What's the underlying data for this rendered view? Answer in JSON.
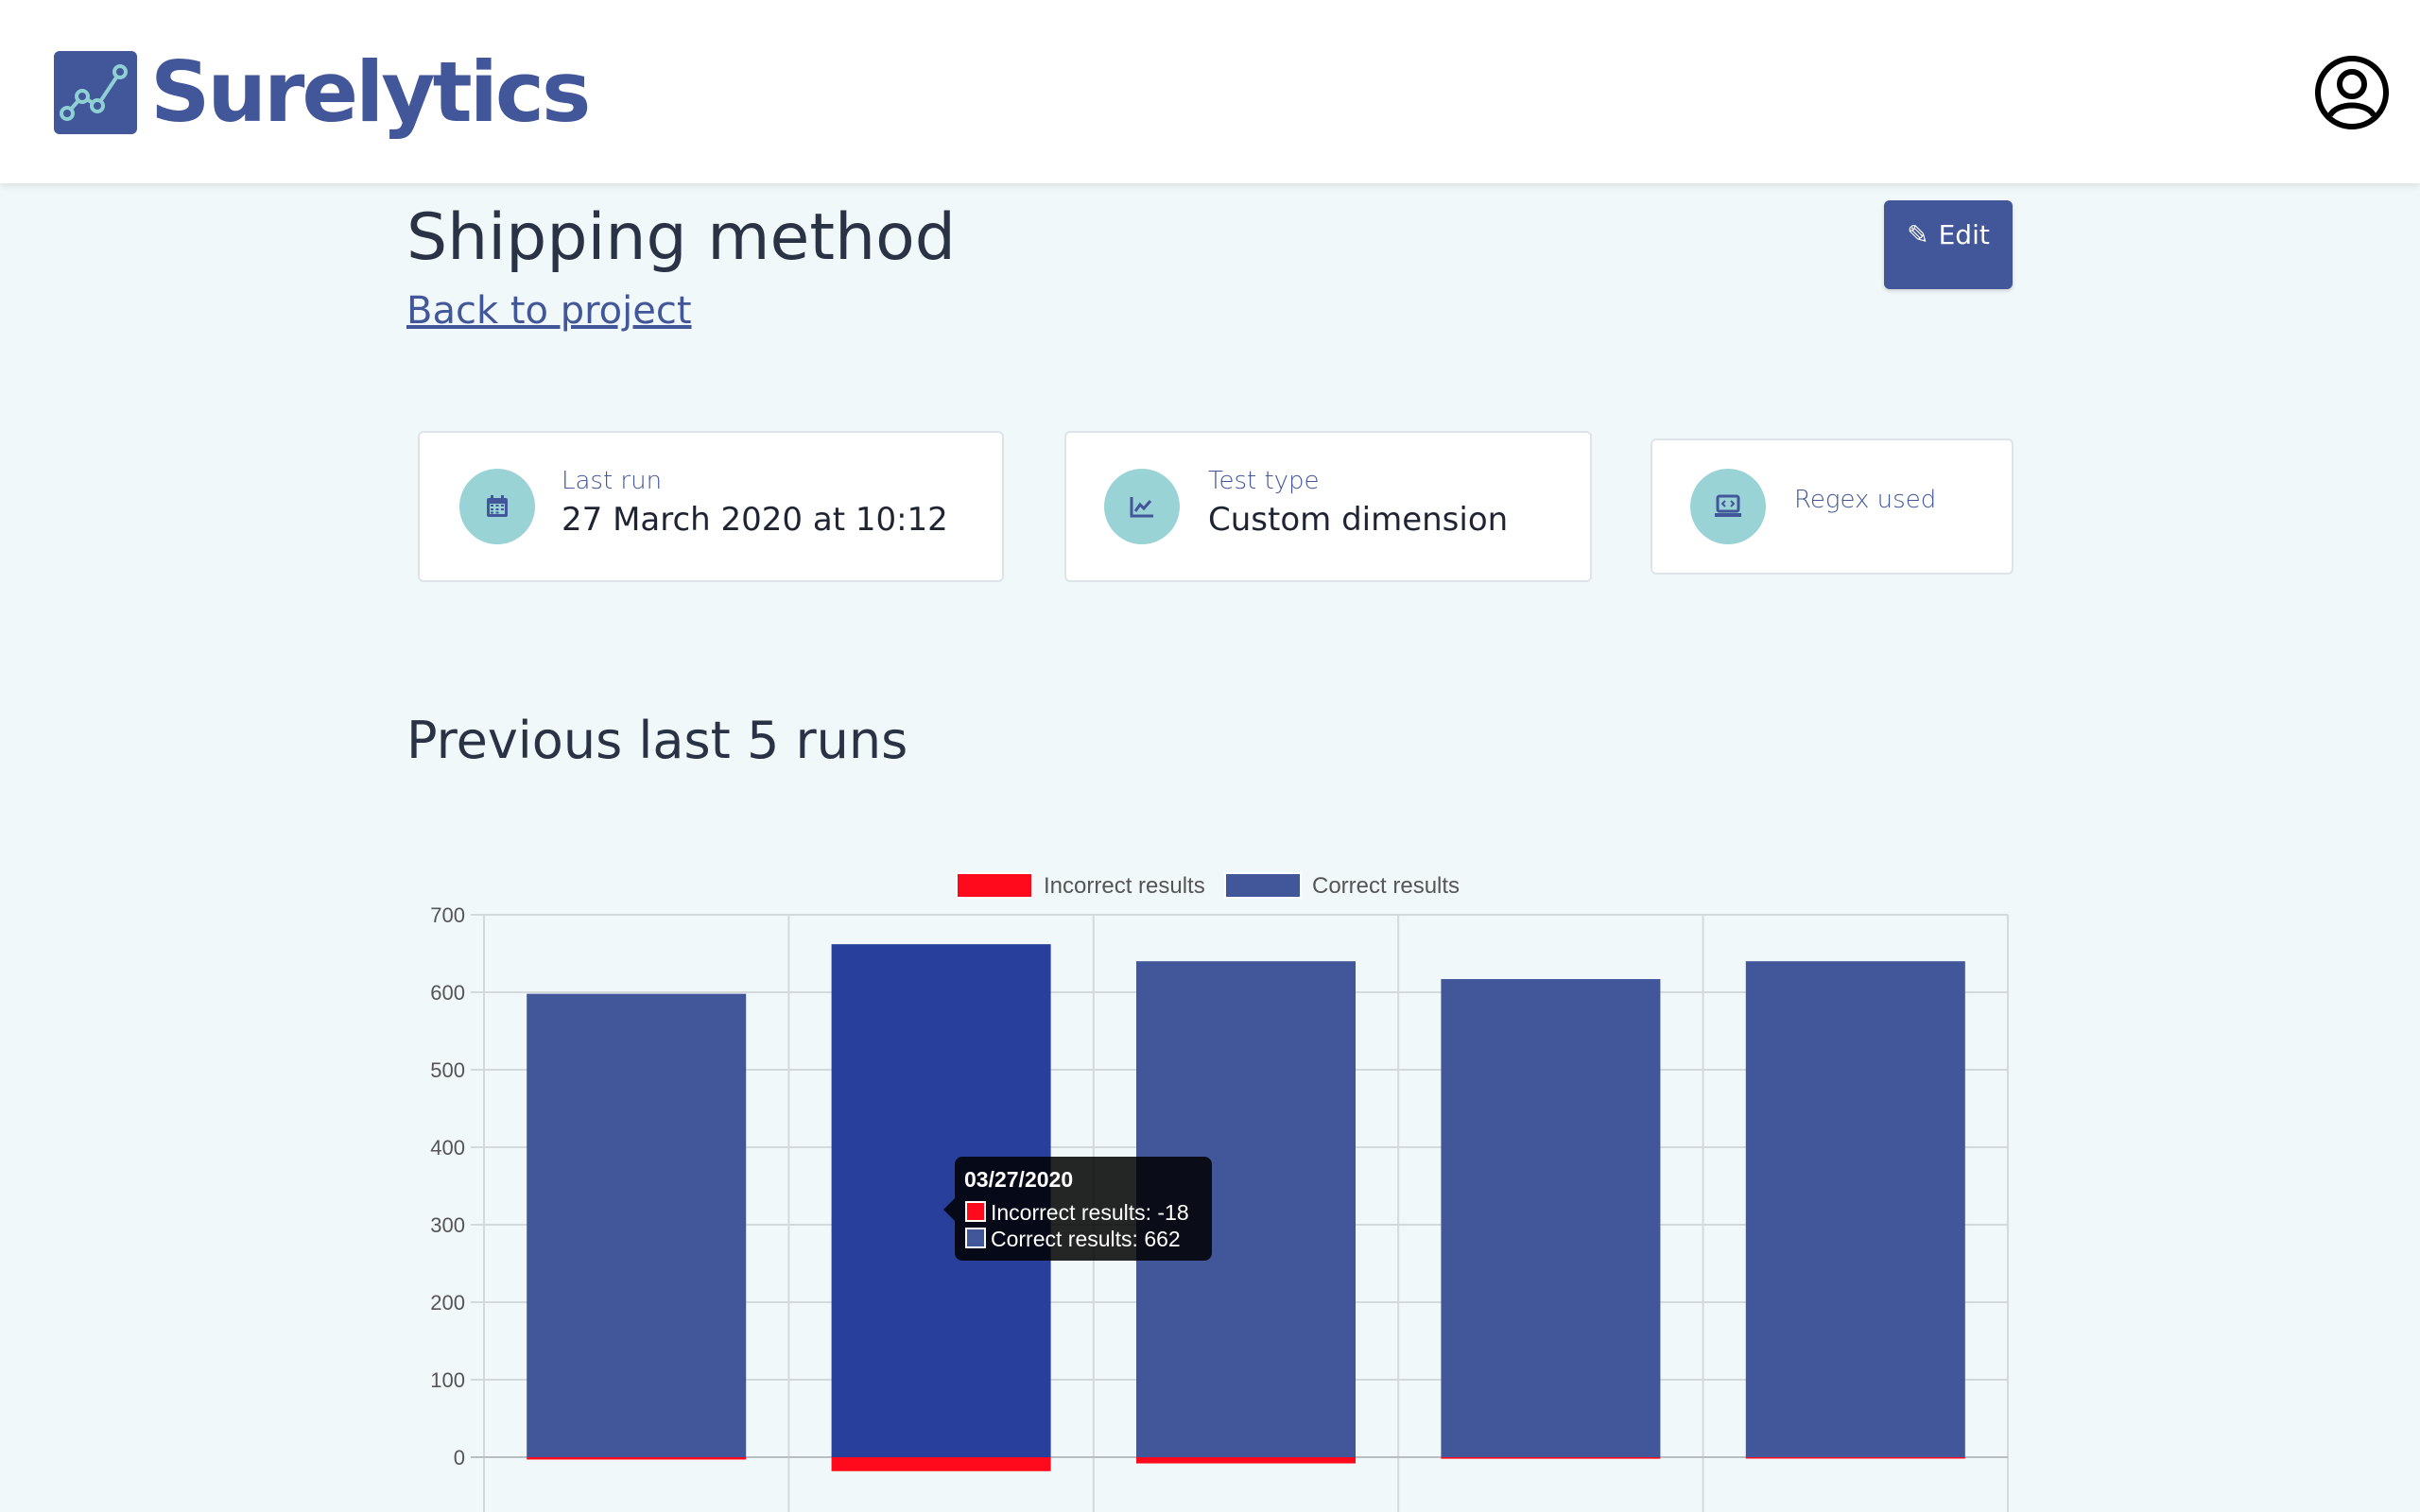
{
  "app": {
    "brand": "Surelytics"
  },
  "header": {
    "title": "Shipping method",
    "back_link": "Back to project",
    "edit_label": "Edit",
    "edit_icon": "pencil-icon"
  },
  "cards": [
    {
      "icon": "calendar-icon",
      "label": "Last run",
      "value": "27 March 2020 at 10:12"
    },
    {
      "icon": "chart-line-icon",
      "label": "Test type",
      "value": "Custom dimension"
    },
    {
      "icon": "code-laptop-icon",
      "label": "Regex used",
      "value": ""
    }
  ],
  "section": {
    "title": "Previous last 5 runs"
  },
  "colors": {
    "brand": "#42569a",
    "incorrect": "#ff0a1c",
    "correct": "#42569a",
    "correct_hover": "#28409c"
  },
  "chart_data": {
    "type": "bar",
    "stacked": true,
    "categories": [
      "",
      "03/27/2020",
      "",
      "",
      ""
    ],
    "series": [
      {
        "name": "Incorrect results",
        "values": [
          -3,
          -18,
          -8,
          -2,
          -1
        ]
      },
      {
        "name": "Correct results",
        "values": [
          598,
          662,
          640,
          617,
          640
        ]
      }
    ],
    "ylim": [
      0,
      700
    ],
    "yticks": [
      0,
      100,
      200,
      300,
      400,
      500,
      600,
      700
    ],
    "grid": true,
    "legend": "top-center",
    "tooltip": {
      "title": "03/27/2020",
      "lines": [
        "Incorrect results: -18",
        "Correct results: 662"
      ],
      "category_index": 1
    }
  }
}
